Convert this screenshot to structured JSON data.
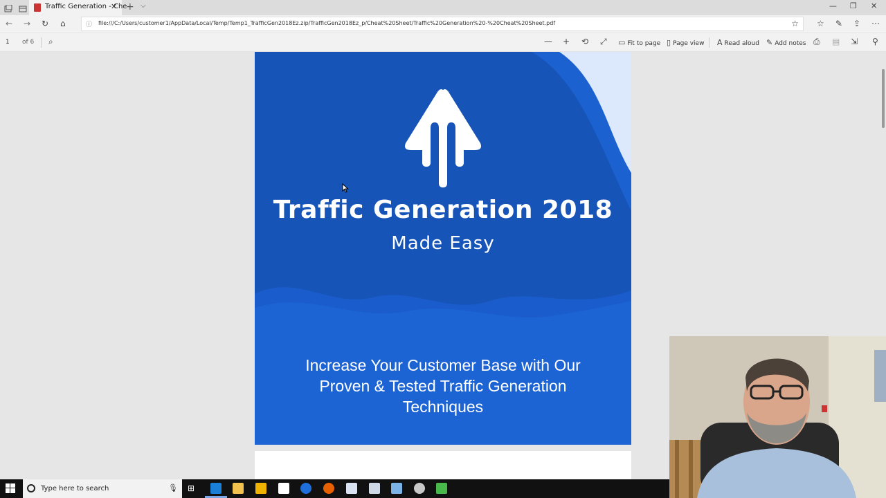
{
  "browser": {
    "tab_title": "Traffic Generation - Che",
    "close_glyph": "✕",
    "new_tab_glyph": "+",
    "url": "file:///C:/Users/customer1/AppData/Local/Temp/Temp1_TrafficGen2018Ez.zip/TrafficGen2018Ez_p/Cheat%20Sheet/Traffic%20Generation%20-%20Cheat%20Sheet.pdf"
  },
  "pdf_toolbar": {
    "page_number": "1",
    "page_of": "of 6",
    "fit_to_page": "Fit to page",
    "page_view": "Page view",
    "read_aloud": "Read aloud",
    "add_notes": "Add notes"
  },
  "document": {
    "headline": "Traffic Generation 2018",
    "subheadline": "Made Easy",
    "tagline": "Increase Your Customer Base with Our Proven & Tested Traffic Generation Techniques"
  },
  "taskbar": {
    "search_placeholder": "Type here to search"
  },
  "colors": {
    "cover_blue": "#1654b7",
    "cover_light_blue": "#1c63d4",
    "taskbar": "#111111"
  }
}
